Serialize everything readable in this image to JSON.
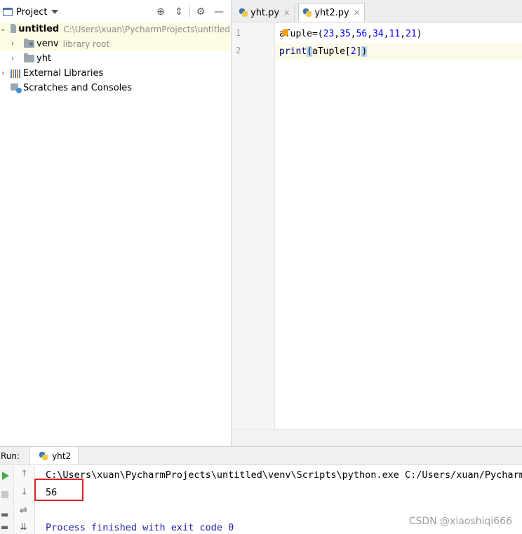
{
  "project": {
    "title": "Project",
    "tree": [
      {
        "label": "untitled",
        "path": "C:\\Users\\xuan\\PycharmProjects\\untitled"
      },
      {
        "label": "venv",
        "hint": "library root"
      },
      {
        "label": "yht"
      },
      {
        "label": "External Libraries"
      },
      {
        "label": "Scratches and Consoles"
      }
    ]
  },
  "editor": {
    "tabs": [
      {
        "label": "yht.py",
        "close": "✕"
      },
      {
        "label": "yht2.py",
        "close": "✕"
      }
    ],
    "active_tab": 1,
    "lines": [
      {
        "no": "1",
        "code": "aTuple=(23,35,56,34,11,21)"
      },
      {
        "no": "2",
        "code": "print(aTuple[2])"
      }
    ]
  },
  "run": {
    "label": "Run:",
    "tab": "yht2",
    "output": [
      "C:\\Users\\xuan\\PycharmProjects\\untitled\\venv\\Scripts\\python.exe C:/Users/xuan/PycharmP",
      "56",
      "",
      "Process finished with exit code 0"
    ]
  },
  "watermark": "CSDN @xiaoshiqi666",
  "colors": {
    "highlight": "#e0201f",
    "current_line": "#fcfae8",
    "selected_row": "#fdfbe3"
  }
}
